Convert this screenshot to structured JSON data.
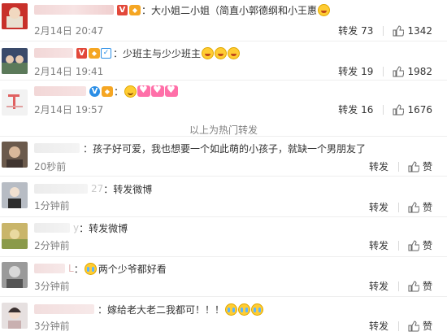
{
  "hot_reposts": [
    {
      "badges": [
        "V",
        "gold"
      ],
      "text": "大小姐二小姐（简直小郭德纲和小王惠",
      "emojis": [
        "laugh"
      ],
      "time": "2月14日 20:47",
      "repost_label": "转发",
      "repost_count": "73",
      "like_count": "1342",
      "avatar_color": "#c8302a"
    },
    {
      "badges": [
        "V",
        "gold",
        "check"
      ],
      "text": "少班主与少少班主",
      "emojis": [
        "laugh",
        "laugh",
        "laugh"
      ],
      "time": "2月14日 19:41",
      "repost_label": "转发",
      "repost_count": "19",
      "like_count": "1982",
      "avatar_color": "#3a4a6a"
    },
    {
      "badges": [
        "blue-V",
        "gold"
      ],
      "text": "",
      "emojis": [
        "smile",
        "heart",
        "heart",
        "heart"
      ],
      "time": "2月14日 19:57",
      "repost_label": "转发",
      "repost_count": "16",
      "like_count": "1676",
      "avatar_color": "#e8e8e8"
    }
  ],
  "hot_divider_label": "以上为热门转发",
  "reposts": [
    {
      "text": "孩子好可爱，我也想要一个如此萌的小孩子，就缺一个男朋友了",
      "emojis": [],
      "time": "20秒前",
      "repost_label": "转发",
      "like_label": "赞",
      "avatar_color": "#8a7a6a"
    },
    {
      "partial_name": "27",
      "text": "转发微博",
      "emojis": [],
      "time": "1分钟前",
      "repost_label": "转发",
      "like_label": "赞",
      "avatar_color": "#b7bcc4"
    },
    {
      "partial_name": "y",
      "text": "转发微博",
      "emojis": [],
      "time": "2分钟前",
      "repost_label": "转发",
      "like_label": "赞",
      "avatar_color": "#c9b56a"
    },
    {
      "partial_name": "L",
      "text": "两个少爷都好看",
      "emojis": [
        "cry"
      ],
      "time": "3分钟前",
      "repost_label": "转发",
      "like_label": "赞",
      "avatar_color": "#9a9a9a"
    },
    {
      "text": "嫁给老大老二我都可！！！",
      "emojis": [
        "cry",
        "cry",
        "cry"
      ],
      "time": "3分钟前",
      "repost_label": "转发",
      "like_label": "赞",
      "avatar_color": "#d0c8c8"
    }
  ],
  "colors": {
    "divider": "#eeeeee",
    "meta_gray": "#808080",
    "vip_red": "#e2483a",
    "gold": "#f5a623",
    "blue_v": "#2b8ee6"
  }
}
